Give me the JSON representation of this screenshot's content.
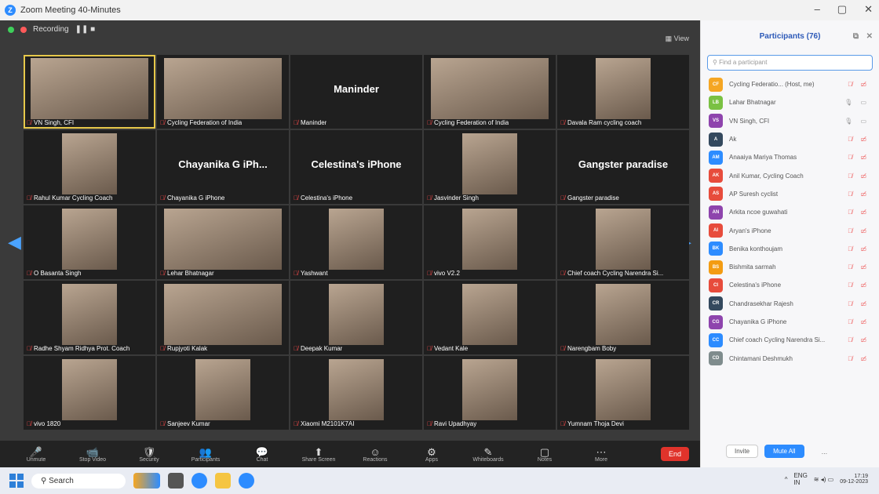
{
  "window": {
    "title": "Zoom Meeting 40-Minutes"
  },
  "topbar": {
    "recording_label": "Recording",
    "view_label": "View"
  },
  "tiles": [
    {
      "name": "VN Singh, CFI",
      "big": "",
      "video": true,
      "active": true,
      "wide": true
    },
    {
      "name": "Cycling Federation of India",
      "big": "",
      "video": true,
      "wide": true
    },
    {
      "name": "Maninder",
      "big": "Maninder",
      "video": false
    },
    {
      "name": "Cycling Federation of India",
      "big": "",
      "video": true,
      "wide": true
    },
    {
      "name": "Davala Ram cycling coach",
      "big": "",
      "video": true
    },
    {
      "name": "Rahul Kumar Cycling Coach",
      "big": "",
      "video": true
    },
    {
      "name": "Chayanika G iPhone",
      "big": "Chayanika G iPh...",
      "video": false
    },
    {
      "name": "Celestina's iPhone",
      "big": "Celestina's iPhone",
      "video": false
    },
    {
      "name": "Jasvinder Singh",
      "big": "",
      "video": true
    },
    {
      "name": "Gangster paradise",
      "big": "Gangster paradise",
      "video": false
    },
    {
      "name": "O Basanta Singh",
      "big": "",
      "video": true
    },
    {
      "name": "Lehar Bhatnagar",
      "big": "",
      "video": true,
      "wide": true
    },
    {
      "name": "Yashwant",
      "big": "",
      "video": true
    },
    {
      "name": "vivo V2.2",
      "big": "",
      "video": true
    },
    {
      "name": "Chief coach Cycling Narendra Si...",
      "big": "",
      "video": true
    },
    {
      "name": "Radhe Shyam Ridhya Prot. Coach",
      "big": "",
      "video": true
    },
    {
      "name": "Rupjyoti Kalak",
      "big": "",
      "video": true,
      "wide": true
    },
    {
      "name": "Deepak Kumar",
      "big": "",
      "video": true
    },
    {
      "name": "Vedant Kale",
      "big": "",
      "video": true
    },
    {
      "name": "Narengbam Boby",
      "big": "",
      "video": true
    },
    {
      "name": "vivo 1820",
      "big": "",
      "video": true
    },
    {
      "name": "Sanjeev Kumar",
      "big": "",
      "video": true
    },
    {
      "name": "Xiaomi M2101K7AI",
      "big": "",
      "video": true
    },
    {
      "name": "Ravi Upadhyay",
      "big": "",
      "video": true
    },
    {
      "name": "Yumnam Thoja Devi",
      "big": "",
      "video": true
    }
  ],
  "toolbar": [
    {
      "icon": "🎤",
      "label": "Unmute"
    },
    {
      "icon": "📹",
      "label": "Stop Video"
    },
    {
      "icon": "🛡",
      "label": "Security"
    },
    {
      "icon": "👥",
      "label": "Participants"
    },
    {
      "icon": "💬",
      "label": "Chat"
    },
    {
      "icon": "⬆",
      "label": "Share Screen"
    },
    {
      "icon": "☺",
      "label": "Reactions"
    },
    {
      "icon": "⚙",
      "label": "Apps"
    },
    {
      "icon": "✎",
      "label": "Whiteboards"
    },
    {
      "icon": "▢",
      "label": "Notes"
    },
    {
      "icon": "⋯",
      "label": "More"
    }
  ],
  "end_label": "End",
  "panel": {
    "title": "Participants (76)",
    "search_placeholder": "Find a participant",
    "participants": [
      {
        "initials": "CF",
        "color": "#f5a623",
        "name": "Cycling Federatio... (Host, me)",
        "muted": true
      },
      {
        "initials": "LB",
        "color": "#7ac143",
        "name": "Lahar Bhatnagar",
        "muted": false
      },
      {
        "initials": "VS",
        "color": "#8e44ad",
        "name": "VN Singh, CFI",
        "muted": false
      },
      {
        "initials": "A",
        "color": "#34495e",
        "name": "Ak",
        "muted": true
      },
      {
        "initials": "AM",
        "color": "#2d8cff",
        "name": "Anaaiya Mariya Thomas",
        "muted": true
      },
      {
        "initials": "AK",
        "color": "#e74c3c",
        "name": "Anil Kumar, Cycling Coach",
        "muted": true
      },
      {
        "initials": "AS",
        "color": "#e74c3c",
        "name": "AP Suresh cyclist",
        "muted": true
      },
      {
        "initials": "AN",
        "color": "#8e44ad",
        "name": "Arkita ncoe guwahati",
        "muted": true
      },
      {
        "initials": "AI",
        "color": "#e74c3c",
        "name": "Aryan's iPhone",
        "muted": true
      },
      {
        "initials": "BK",
        "color": "#2d8cff",
        "name": "Benika konthoujam",
        "muted": true
      },
      {
        "initials": "BS",
        "color": "#f39c12",
        "name": "Bishmita sarmah",
        "muted": true
      },
      {
        "initials": "CI",
        "color": "#e74c3c",
        "name": "Celestina's iPhone",
        "muted": true
      },
      {
        "initials": "CR",
        "color": "#34495e",
        "name": "Chandrasekhar Rajesh",
        "muted": true
      },
      {
        "initials": "CG",
        "color": "#8e44ad",
        "name": "Chayanika G iPhone",
        "muted": true
      },
      {
        "initials": "CC",
        "color": "#2d8cff",
        "name": "Chief coach Cycling Narendra Si...",
        "muted": true
      },
      {
        "initials": "CD",
        "color": "#7f8c8d",
        "name": "Chintamani Deshmukh",
        "muted": true
      }
    ],
    "invite_label": "Invite",
    "mute_all_label": "Mute All",
    "more_label": "..."
  },
  "taskbar": {
    "search_label": "Search",
    "lang": "ENG",
    "region": "IN",
    "time": "17:19",
    "date": "09-12-2023"
  }
}
